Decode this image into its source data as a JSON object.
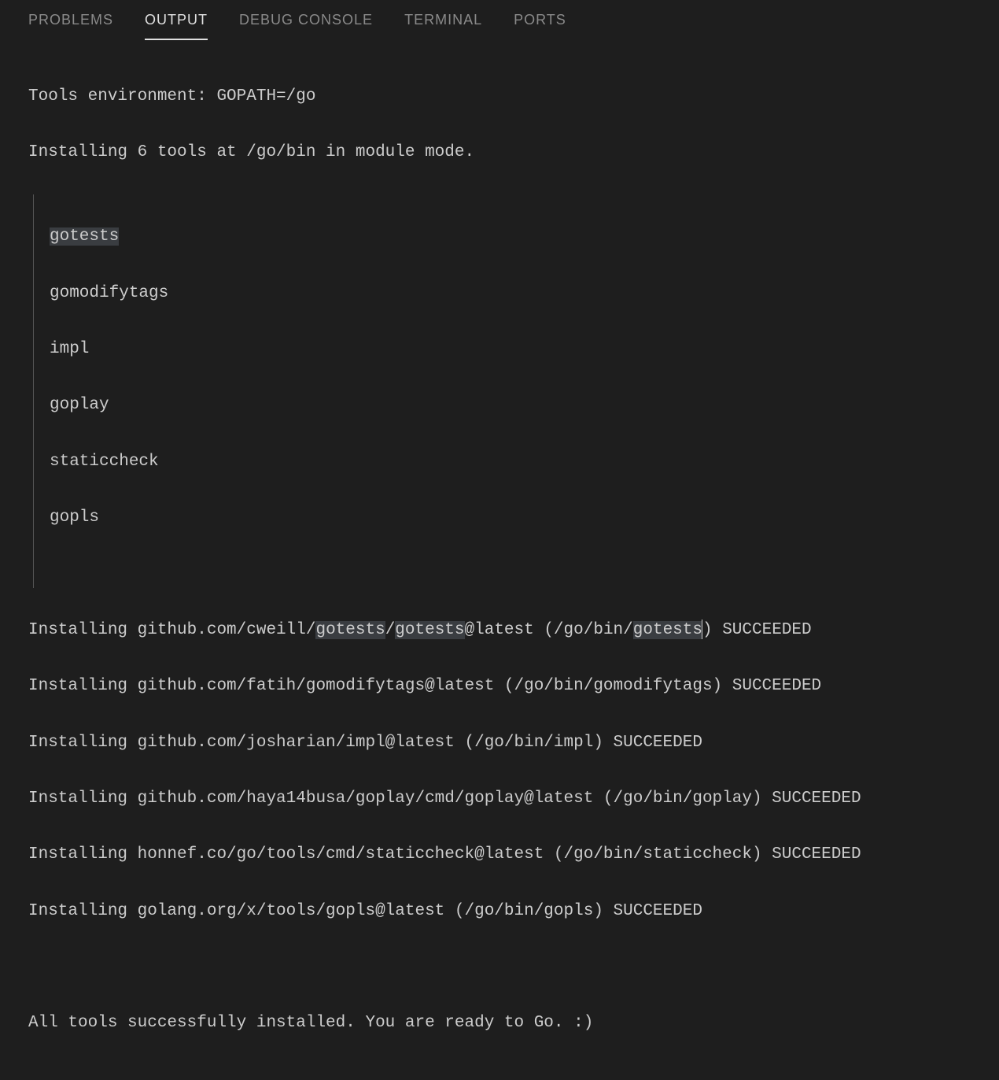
{
  "tabs": {
    "problems": "PROBLEMS",
    "output": "OUTPUT",
    "debug": "DEBUG CONSOLE",
    "terminal": "TERMINAL",
    "ports": "PORTS"
  },
  "output": {
    "line1": "Tools environment: GOPATH=/go",
    "line2": "Installing 6 tools at /go/bin in module mode.",
    "tools": [
      "gotests",
      "gomodifytags",
      "impl",
      "goplay",
      "staticcheck",
      "gopls"
    ],
    "install_lines": {
      "l1_a": "Installing github.com/cweill/",
      "l1_b": "gotests",
      "l1_c": "/",
      "l1_d": "gotests",
      "l1_e": "@latest (/go/bin/",
      "l1_f": "gotests",
      "l1_g": ") SUCCEEDED",
      "l2": "Installing github.com/fatih/gomodifytags@latest (/go/bin/gomodifytags) SUCCEEDED",
      "l3": "Installing github.com/josharian/impl@latest (/go/bin/impl) SUCCEEDED",
      "l4": "Installing github.com/haya14busa/goplay/cmd/goplay@latest (/go/bin/goplay) SUCCEEDED",
      "l5": "Installing honnef.co/go/tools/cmd/staticcheck@latest (/go/bin/staticcheck) SUCCEEDED",
      "l6": "Installing golang.org/x/tools/gopls@latest (/go/bin/gopls) SUCCEEDED"
    },
    "footer": "All tools successfully installed. You are ready to Go. :)"
  }
}
